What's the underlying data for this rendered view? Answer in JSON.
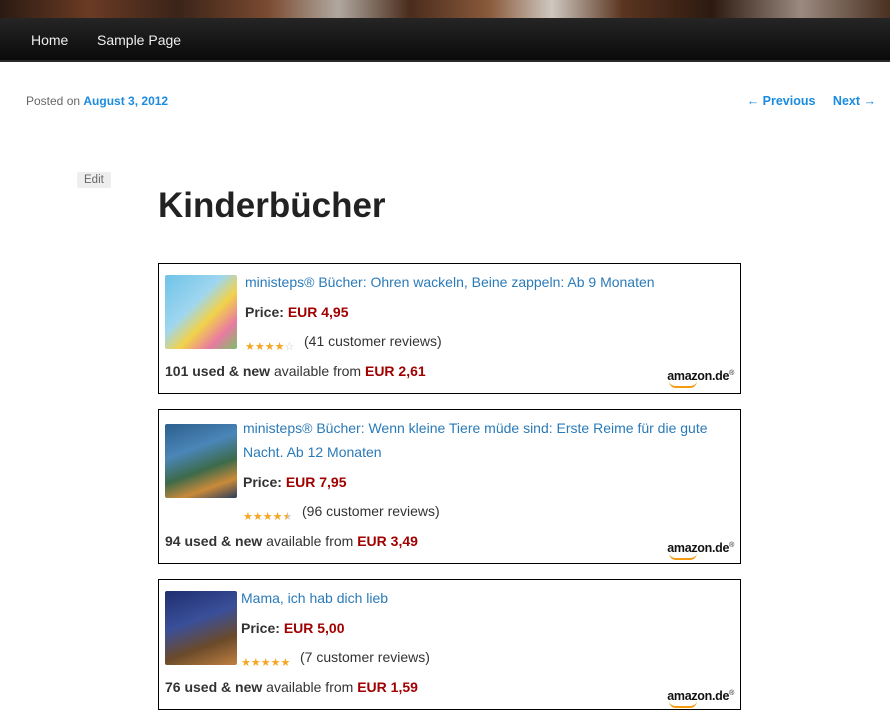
{
  "nav": {
    "items": [
      "Home",
      "Sample Page"
    ]
  },
  "post": {
    "posted_prefix": "Posted on",
    "date": "August 3, 2012",
    "prev": "← Previous",
    "next": "Next →",
    "edit": "Edit",
    "title": "Kinderbücher"
  },
  "products": [
    {
      "title_line1": "ministeps® Bücher: Ohren wackeln, Beine zappeln: Ab 9 Monaten",
      "title_line2": "",
      "price_label": "Price:",
      "price": "EUR 4,95",
      "rating": 4,
      "reviews": "(41 customer reviews)",
      "avail_count": "101 used & new",
      "avail_mid": "available from",
      "avail_price": "EUR 2,61",
      "logo": "amazon.de"
    },
    {
      "title_line1": "ministeps® Bücher: Wenn kleine Tiere müde sind: Erste Reime für die gute",
      "title_line2": "Nacht. Ab 12 Monaten",
      "price_label": "Price:",
      "price": "EUR 7,95",
      "rating": 4.5,
      "reviews": "(96 customer reviews)",
      "avail_count": "94 used & new",
      "avail_mid": "available from",
      "avail_price": "EUR 3,49",
      "logo": "amazon.de"
    },
    {
      "title_line1": "Mama, ich hab dich lieb",
      "title_line2": "",
      "price_label": "Price:",
      "price": "EUR 5,00",
      "rating": 5,
      "reviews": "(7 customer reviews)",
      "avail_count": "76 used & new",
      "avail_mid": "available from",
      "avail_price": "EUR 1,59",
      "logo": "amazon.de"
    }
  ],
  "colors": {
    "link": "#1b8be0",
    "price": "#a10000",
    "nav_bg": "#111111",
    "star": "#f5a623"
  }
}
